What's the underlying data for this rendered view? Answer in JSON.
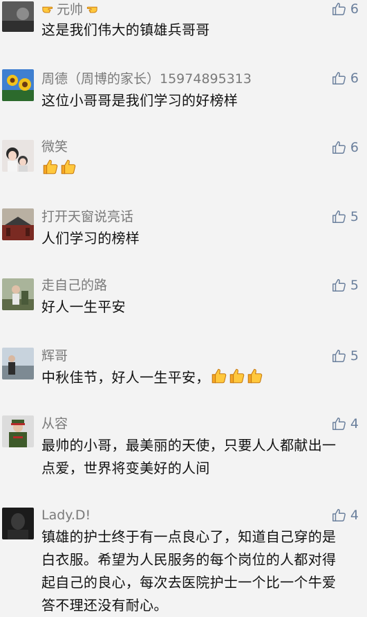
{
  "comments": [
    {
      "name": "元帅",
      "text": "这是我们伟大的镇雄兵哥哥",
      "likes": "6"
    },
    {
      "name": "周德（周博的家长）15974895313",
      "text": "这位小哥哥是我们学习的好榜样",
      "likes": "6"
    },
    {
      "name": "微笑",
      "text": "",
      "likes": "6"
    },
    {
      "name": "打开天窗说亮话",
      "text": "人们学习的榜样",
      "likes": "5"
    },
    {
      "name": "走自己的路",
      "text": "好人一生平安",
      "likes": "5"
    },
    {
      "name": "辉哥",
      "text": "中秋佳节，好人一生平安，",
      "likes": "5"
    },
    {
      "name": "从容",
      "text": "最帅的小哥，最美丽的天使，只要人人都献出一点爱，世界将变美好的人间",
      "likes": "4"
    },
    {
      "name": "Lady.D!",
      "text": "镇雄的护士终于有一点良心了，知道自己穿的是白衣服。希望为人民服务的每个岗位的人都对得起自己的良心，每次去医院护士一个比一个牛爱答不理还没有耐心。",
      "likes": "4"
    }
  ],
  "icons": {
    "like": "thumbs-up-outline-icon",
    "emoji_point": "pointing-hand-emoji",
    "emoji_thumb": "thumbs-up-emoji"
  },
  "colors": {
    "like": "#6a7f9c",
    "name": "#7a7a7a",
    "background": "#f3f3f3"
  }
}
